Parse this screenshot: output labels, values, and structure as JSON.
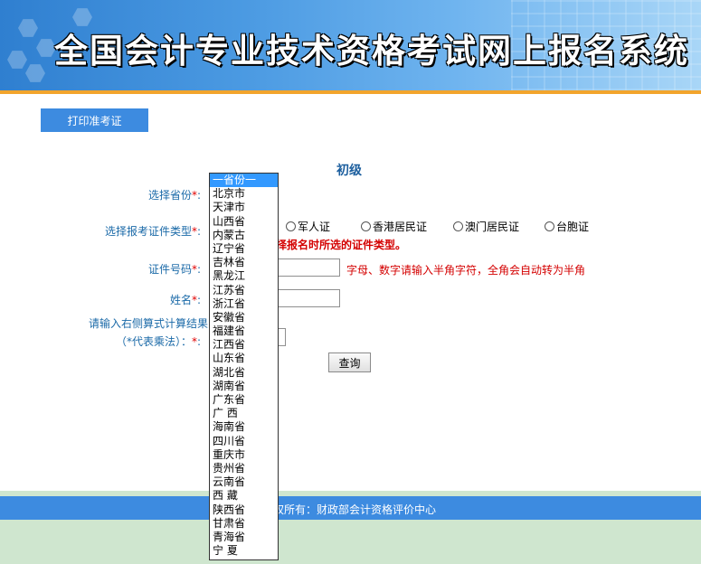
{
  "header": {
    "title": "全国会计专业技术资格考试网上报名系统"
  },
  "print_button": "打印准考证",
  "level": "初级",
  "form": {
    "province_label": "选择省份",
    "idtype_label": "选择报考证件类型",
    "id_options": [
      "军人证",
      "香港居民证",
      "澳门居民证",
      "台胞证"
    ],
    "idtype_warning": "择报名时所选的证件类型。",
    "idnumber_label": "证件号码",
    "idnumber_hint": "字母、数字请输入半角字符，全角会自动转为半角",
    "name_label": "姓名",
    "calc_label_line1": "请输入右侧算式计算结果",
    "calc_label_line2": "（*代表乘法）：",
    "required_mark": "*",
    "colon": ":",
    "query_button": "查询"
  },
  "footer": {
    "text": "权所有：财政部会计资格评价中心"
  },
  "province_dropdown": {
    "placeholder": "一省份一",
    "options": [
      "北京市",
      "天津市",
      "山西省",
      "内蒙古",
      "辽宁省",
      "吉林省",
      "黑龙江",
      "江苏省",
      "浙江省",
      "安徽省",
      "福建省",
      "江西省",
      "山东省",
      "湖北省",
      "湖南省",
      "广东省",
      "广 西",
      "海南省",
      "四川省",
      "重庆市",
      "贵州省",
      "云南省",
      "西 藏",
      "陕西省",
      "甘肃省",
      "青海省",
      "宁 夏"
    ]
  },
  "colors": {
    "banner_blue": "#3d8be0",
    "accent_orange": "#f2a42c",
    "label_blue": "#1b6aa8",
    "warning_red": "#d40000",
    "footer_green": "#cfe6cf"
  }
}
